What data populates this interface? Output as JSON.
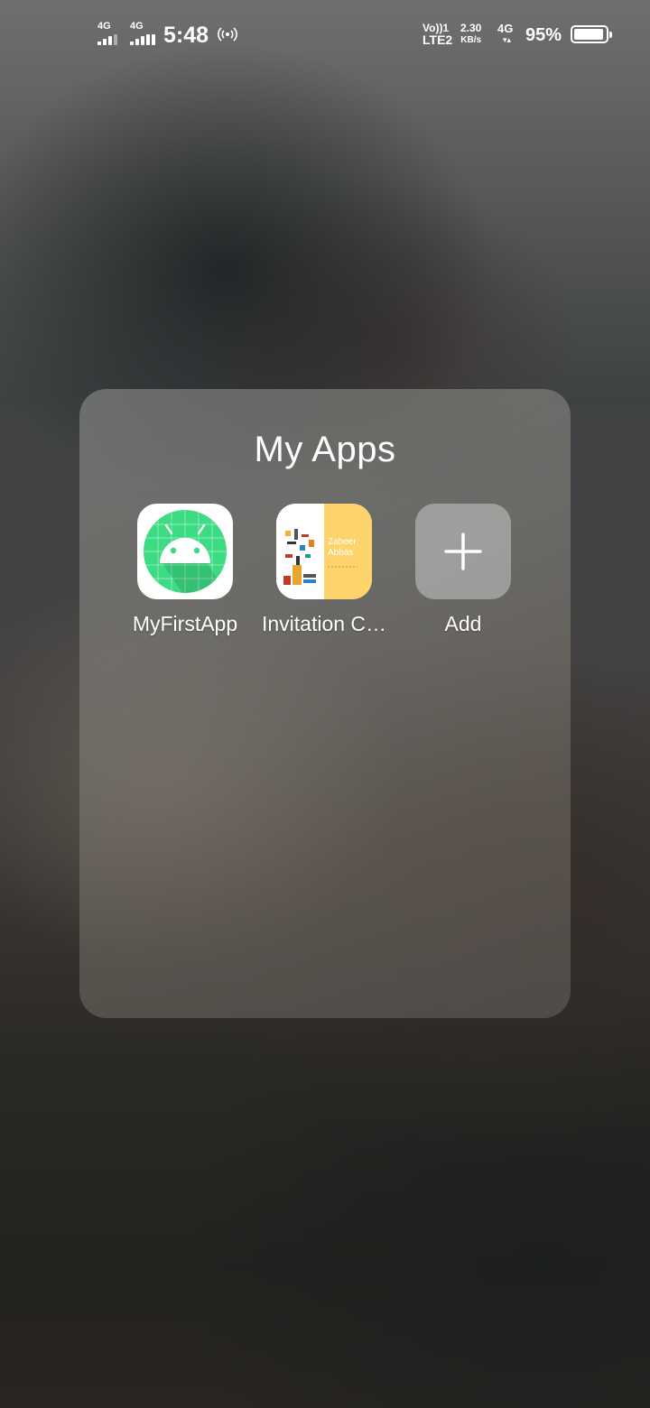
{
  "status_bar": {
    "sim1_network": "4G",
    "sim2_network": "4G",
    "time": "5:48",
    "hotspot_icon": "hotspot-icon",
    "volte_line1": "Vo))1",
    "volte_line2": "LTE2",
    "speed_value": "2.30",
    "speed_unit": "KB/s",
    "data_network": "4G",
    "battery_percent": "95%",
    "battery_level": 0.95
  },
  "folder": {
    "title": "My Apps",
    "apps": [
      {
        "label": "MyFirstApp",
        "icon": "android-icon"
      },
      {
        "label": "Invitation C…",
        "icon": "invitation-card-icon",
        "icon_text_1": "Zaheer",
        "icon_text_2": "Abbas"
      },
      {
        "label": "Add",
        "icon": "plus-icon"
      }
    ]
  },
  "colors": {
    "android_green": "#3ddc84",
    "invite_yellow": "#fdd36b"
  }
}
